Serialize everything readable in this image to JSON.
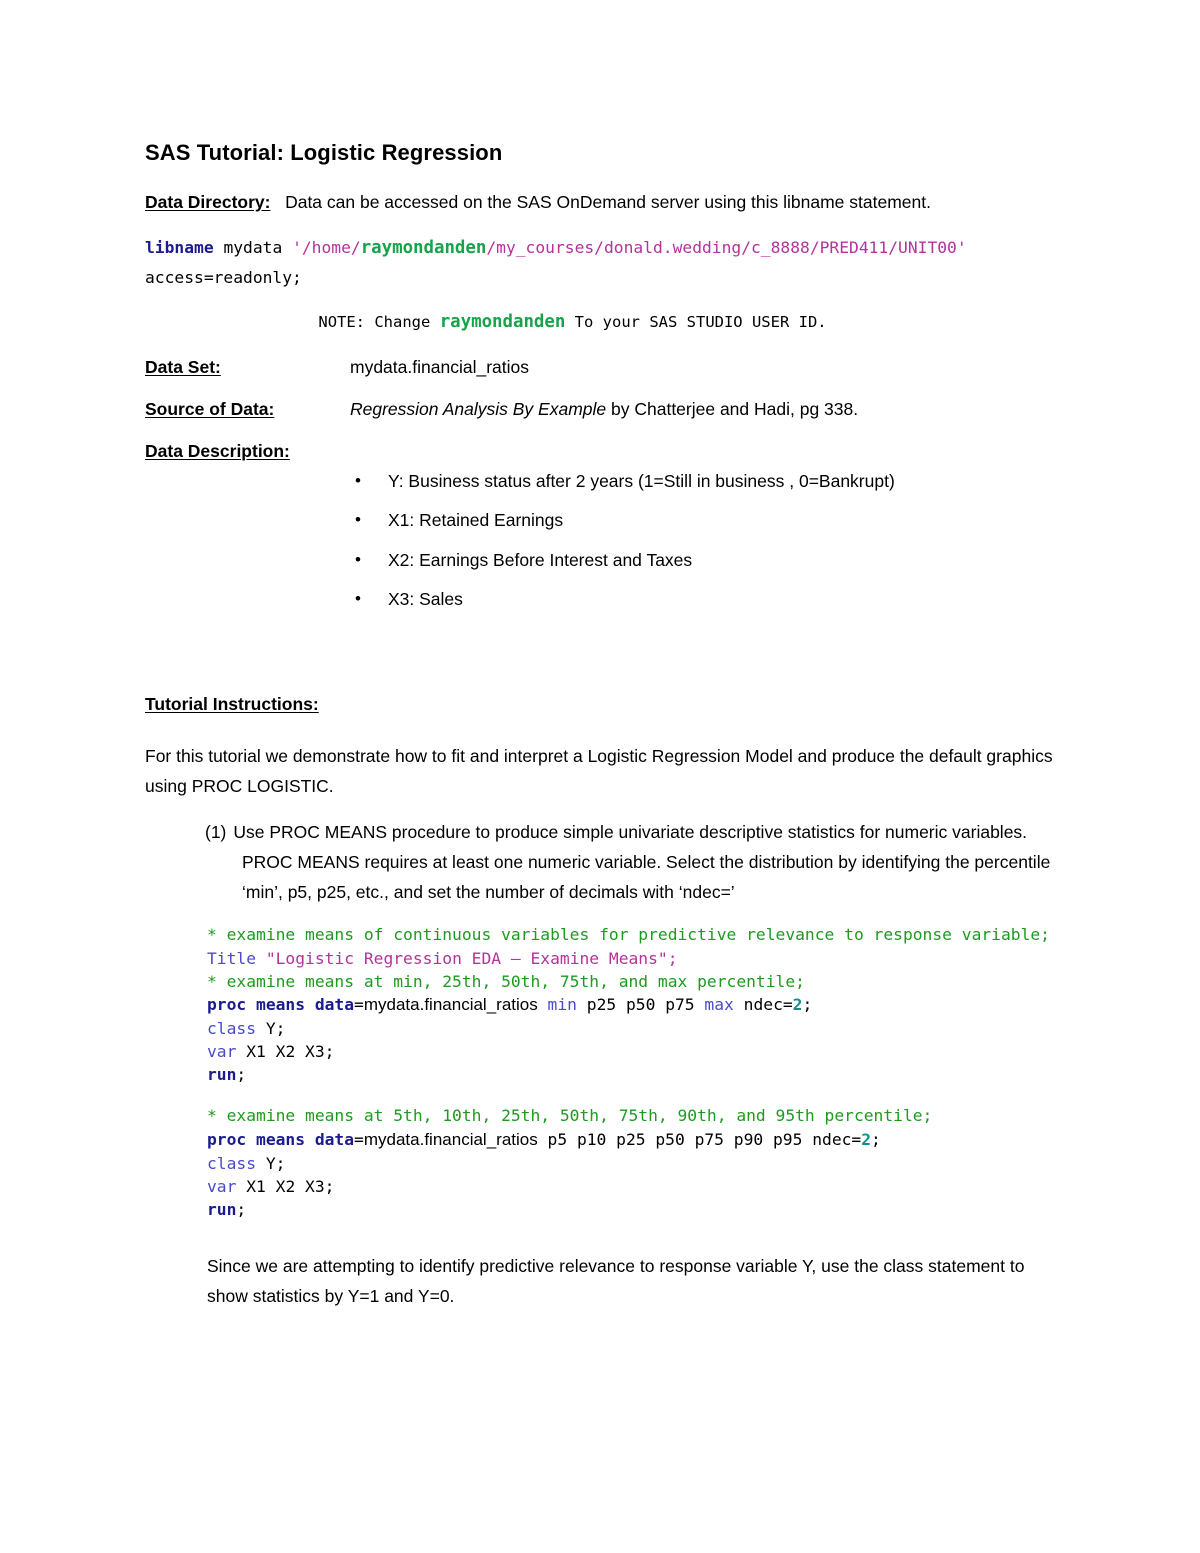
{
  "document": {
    "title": "SAS Tutorial: Logistic Regression",
    "data_directory": {
      "label": "Data Directory:",
      "text": "Data can be accessed on the SAS OnDemand server using this libname statement."
    },
    "libname_statement": {
      "keyword": "libname",
      "library": "mydata",
      "path_prefix": "'/home/",
      "user_id": "raymondanden",
      "path_suffix": "/my_courses/donald.wedding/c_8888/PRED411/UNIT00'",
      "options": "access=readonly;"
    },
    "note": {
      "prefix": "NOTE: Change",
      "user_id": "raymondanden",
      "suffix": "To your SAS STUDIO USER ID."
    },
    "data_set": {
      "label": "Data Set:",
      "value": "mydata.financial_ratios"
    },
    "source_of_data": {
      "label": "Source of Data:",
      "title_italic": "Regression Analysis By Example",
      "rest": " by Chatterjee and Hadi, pg 338."
    },
    "data_description": {
      "label": "Data Description:",
      "items": [
        "Y:   Business status after 2 years (1=Still in business , 0=Bankrupt)",
        "X1: Retained Earnings",
        "X2: Earnings Before Interest and Taxes",
        "X3: Sales"
      ]
    },
    "tutorial_instructions": {
      "label": "Tutorial Instructions:",
      "intro": "For this tutorial we demonstrate how to fit and interpret a Logistic Regression Model and produce the default graphics using PROC LOGISTIC.",
      "step1": {
        "number": "(1)",
        "text": "Use PROC MEANS procedure to produce simple univariate descriptive statistics for numeric variables.  PROC MEANS requires at least one numeric variable.  Select the distribution by identifying the percentile ‘min’, p5, p25, etc., and set the number of decimals with ‘ndec=’"
      },
      "closing": "Since we are attempting to identify predictive relevance to response variable Y, use the class statement to show statistics by Y=1 and Y=0."
    },
    "code_block_1": {
      "comment_1": "* examine means of continuous variables for predictive relevance to response variable;",
      "title_keyword": "Title",
      "title_string": "\"Logistic Regression EDA – Examine Means\";",
      "comment_2": "* examine means at min, 25th, 50th, 75th, and max percentile;",
      "proc_keyword": "proc means data",
      "eq": "=",
      "dataset": "mydata.financial_ratios",
      "stat_min": "min",
      "stats_mid": "p25 p50 p75",
      "stat_max": "max",
      "ndec_label": "ndec=",
      "ndec_value": "2",
      "semicolon": ";",
      "class_keyword": "class",
      "class_value": "Y;",
      "var_keyword": "var",
      "var_value": "X1 X2 X3;",
      "run_keyword": "run",
      "run_semi": ";"
    },
    "code_block_2": {
      "comment_1": "* examine means at 5th, 10th, 25th, 50th, 75th, 90th, and 95th percentile;",
      "proc_keyword": "proc means data",
      "eq": "=",
      "dataset": "mydata.financial_ratios",
      "stats": "p5 p10 p25 p50 p75 p90 p95",
      "ndec_label": "ndec=",
      "ndec_value": "2",
      "semicolon": ";",
      "class_keyword": "class",
      "class_value": "Y;",
      "var_keyword": "var",
      "var_value": "X1 X2 X3;",
      "run_keyword": "run",
      "run_semi": ";"
    }
  },
  "colors": {
    "comment_green": "#1f9a1f",
    "keyword_blue": "#4a4acb",
    "keyword_navy": "#1b1b8f",
    "string_magenta": "#b5329b",
    "number_teal": "#12908f",
    "userid_green": "#17a34a"
  }
}
